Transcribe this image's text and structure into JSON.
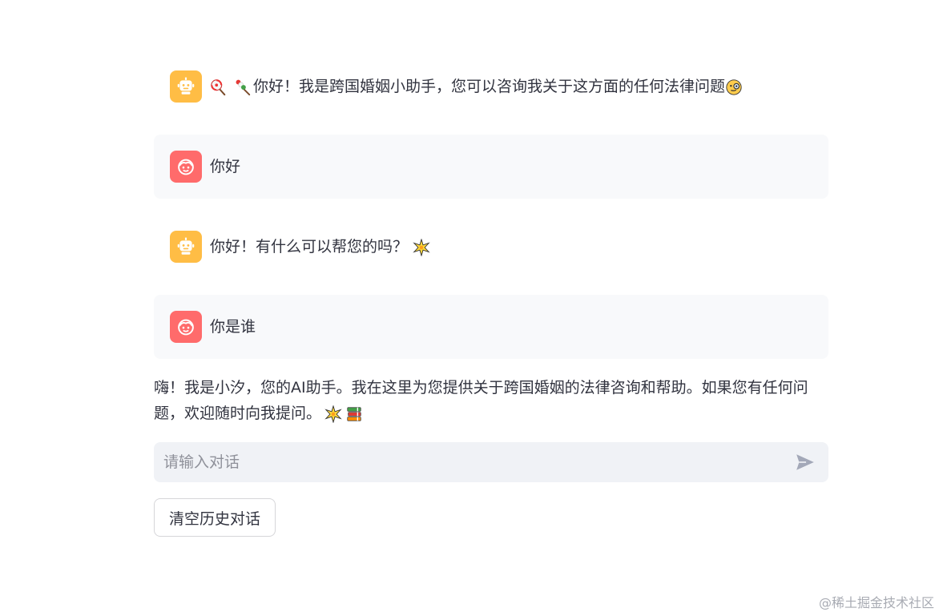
{
  "chat": {
    "messages": [
      {
        "role": "assistant",
        "avatar_icon": "robot-icon",
        "text": "你好！我是跨国婚姻小助手，您可以咨询我关于这方面的任何法律问题"
      },
      {
        "role": "user",
        "avatar_icon": "user-face-icon",
        "text": "你好"
      },
      {
        "role": "assistant",
        "avatar_icon": "robot-icon",
        "text": "你好！有什么可以帮您的吗？"
      },
      {
        "role": "user",
        "avatar_icon": "user-face-icon",
        "text": "你是谁"
      }
    ],
    "streaming_response": "嗨！我是小汐，您的AI助手。我在这里为您提供关于跨国婚姻的法律咨询和帮助。如果您有任何问题，欢迎随时向我提问。"
  },
  "input": {
    "placeholder": "请输入对话",
    "value": ""
  },
  "actions": {
    "clear_label": "清空历史对话"
  },
  "watermark": "@稀土掘金技术社区",
  "icons": {
    "send": "send-icon",
    "greeting_decor": [
      "lollipop-icon",
      "candy-stick-icon"
    ],
    "greeting_end": "monocle-face-icon",
    "sparkle": "sparkle-icon",
    "books": "books-icon"
  },
  "colors": {
    "bot_avatar": "#ffbd45",
    "user_avatar": "#ff6b6b",
    "user_bubble": "#f8f9fb",
    "input_bg": "#f0f2f6",
    "text": "#31333f",
    "placeholder": "#8f919a"
  }
}
